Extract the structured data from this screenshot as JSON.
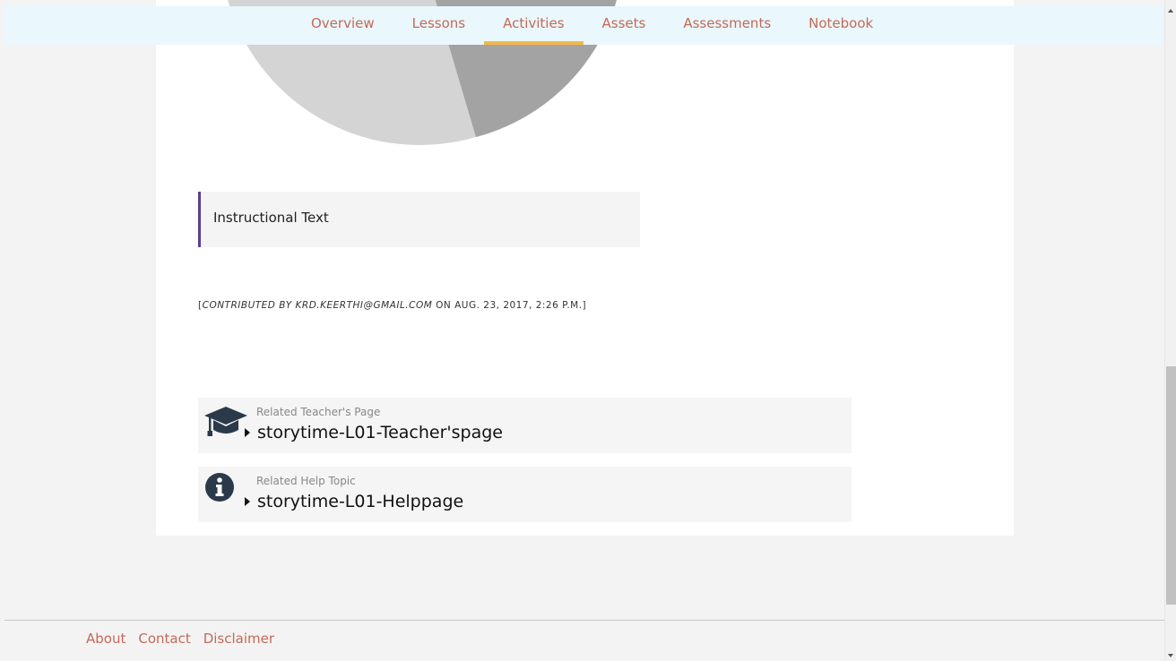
{
  "nav": {
    "tabs": [
      {
        "label": "Overview"
      },
      {
        "label": "Lessons"
      },
      {
        "label": "Activities"
      },
      {
        "label": "Assets"
      },
      {
        "label": "Assessments"
      },
      {
        "label": "Notebook"
      }
    ],
    "active_tab": "Activities",
    "link_color": "#c46a58",
    "active_underline_color": "#f0b84c"
  },
  "main": {
    "pie_colors": [
      "#d4d4d4",
      "#a3a3a3"
    ],
    "instructional_text": "Instructional Text",
    "instructional_border_color": "#5c3d8f",
    "contribution": {
      "open_bracket": "[",
      "prefix": "Contributed by",
      "author": "krd.keerthi@gmail.com",
      "date_text": "on Aug. 23, 2017, 2:26 p.m.]"
    },
    "related": [
      {
        "caption": "Related Teacher's Page",
        "title": "storytime-L01-Teacher'spage",
        "icon": "graduation-cap-icon"
      },
      {
        "caption": "Related Help Topic",
        "title": "storytime-L01-Helppage",
        "icon": "info-circle-icon"
      }
    ]
  },
  "footer": {
    "links": [
      {
        "label": "About"
      },
      {
        "label": "Contact"
      },
      {
        "label": "Disclaimer"
      }
    ]
  }
}
